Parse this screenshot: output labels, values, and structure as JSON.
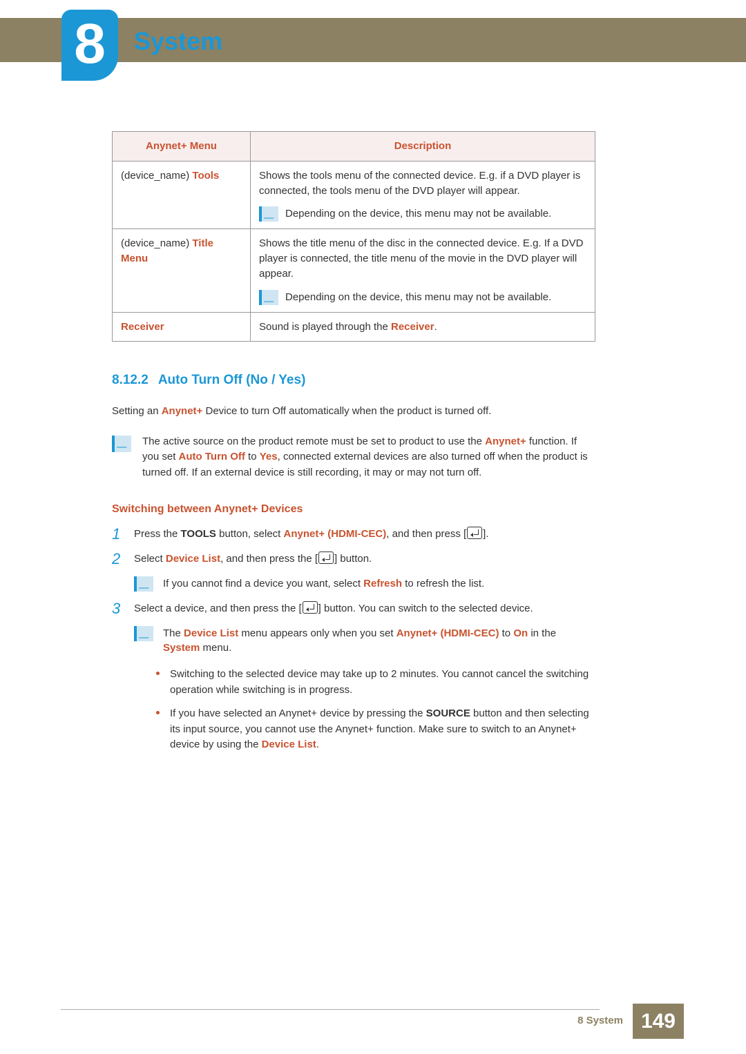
{
  "chapter": {
    "number": "8",
    "title": "System"
  },
  "table": {
    "headers": [
      "Anynet+ Menu",
      "Description"
    ],
    "rows": [
      {
        "left_prefix": "(device_name) ",
        "left_hl": "Tools",
        "desc": "Shows the tools menu of the connected device. E.g. if a DVD player is connected, the tools menu of the DVD player will appear.",
        "note": "Depending on the device, this menu may not be available."
      },
      {
        "left_prefix": "(device_name) ",
        "left_hl": "Title Menu",
        "desc": "Shows the title menu of the disc in the connected device. E.g. If a DVD player is connected, the title menu of the movie in the DVD player will appear.",
        "note": "Depending on the device, this menu may not be available."
      },
      {
        "left_prefix": "",
        "left_hl": "Receiver",
        "desc_prefix": "Sound is played through the ",
        "desc_hl": "Receiver",
        "desc_suffix": "."
      }
    ]
  },
  "section": {
    "number": "8.12.2",
    "title": "Auto Turn Off (No / Yes)",
    "intro": {
      "p1": "Setting an ",
      "hl1": "Anynet+",
      "p2": " Device to turn Off automatically when the product is turned off."
    },
    "note": {
      "t1": "The active source on the product remote must be set to product to use the ",
      "hl1": "Anynet+",
      "t2": " function. If you set ",
      "hl2": "Auto Turn Off",
      "t3": " to ",
      "hl3": "Yes",
      "t4": ", connected external devices are also turned off when the product is turned off. If an external device is still recording, it may or may not turn off."
    }
  },
  "switching": {
    "title": "Switching between Anynet+ Devices",
    "steps": [
      {
        "num": "1",
        "t1": "Press the ",
        "b1": "TOOLS",
        "t2": " button, select ",
        "hl1": "Anynet+ (HDMI-CEC)",
        "t3": ", and then press [",
        "t4": "]."
      },
      {
        "num": "2",
        "t1": "Select ",
        "hl1": "Device List",
        "t2": ", and then press the [",
        "t3": "] button.",
        "sub_note": {
          "t1": "If you cannot find a device you want, select ",
          "hl1": "Refresh",
          "t2": " to refresh the list."
        }
      },
      {
        "num": "3",
        "t1": "Select a device, and then press the [",
        "t2": "] button. You can switch to the selected device.",
        "sub_note": {
          "t1": "The ",
          "hl1": "Device List",
          "t2": " menu appears only when you set ",
          "hl2": "Anynet+ (HDMI-CEC)",
          "t3": " to ",
          "hl3": "On",
          "t4": " in the ",
          "hl4": "System",
          "t5": " menu."
        },
        "bullets": [
          "Switching to the selected device may take up to 2 minutes. You cannot cancel the switching operation while switching is in progress.",
          {
            "t1": "If you have selected an Anynet+ device by pressing the ",
            "b1": "SOURCE",
            "t2": " button and then selecting its input source, you cannot use the Anynet+ function. Make sure to switch to an Anynet+ device by using the ",
            "hl1": "Device List",
            "t3": "."
          }
        ]
      }
    ]
  },
  "footer": {
    "crumb": "8 System",
    "page": "149"
  }
}
